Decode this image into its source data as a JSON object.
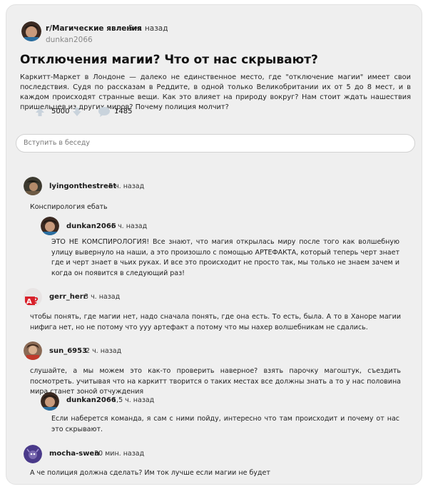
{
  "post": {
    "subreddit": "r/Магические явления",
    "time": "5 ч. назад",
    "author": "dunkan2066",
    "title": "Отключения магии? Что от нас скрывают?",
    "body": "Каркитт-Маркет в Лондоне — далеко не единственное место, где \"отключение магии\" имеет свои последствия. Судя по рассказам в Реддите, в одной только Великобритании их от 5 до 8 мест, и в каждом происходят странные вещи. Как это влияет на природу вокруг? Нам стоит ждать нашествия пришельцев из других миров? Почему полиция молчит?",
    "upvotes": "5000",
    "comments_count": "1485"
  },
  "input": {
    "placeholder": "Вступить в беседу"
  },
  "comments": [
    {
      "user": "lyingonthestreet",
      "time": "5 ч. назад",
      "text": "Конспирология ебать"
    },
    {
      "user": "dunkan2066",
      "time": "5 ч. назад",
      "text": "ЭТО НЕ КОМСПИРОЛОГИЯ! Все знают, что магия открылась миру после того как волшебную улицу вывернуло на наши, а это произошло с помощью АРТЕФАКТА, который теперь черт знает где и черт знает в чьих руках. И все это происходит не просто так, мы только не знаем зачем и когда он появится в следующий раз!"
    },
    {
      "user": "gerr_herr",
      "time": "3 ч. назад",
      "text": "чтобы понять, где магии нет, надо сначала понять, где она есть. То есть, была. А то в Ханоре магии нифига нет, но не потому что ууу артефакт а потому что мы нахер волшебникам не сдались."
    },
    {
      "user": "sun_6953",
      "time": "2 ч. назад",
      "text": "слушайте, а мы можем это как-то проверить наверное? взять парочку магоштук, съездить посмотреть. учитывая что на каркитт творится о таких местах все должны знать а то у нас половина мира станет зоной отчуждения"
    },
    {
      "user": "dunkan2066",
      "time": "1,5 ч. назад",
      "text": "Если наберется команда, я сам с ними пойду, интересно что там происходит и почему от нас это скрывают."
    },
    {
      "user": "mocha-swen",
      "time": "30 мин. назад",
      "text": "А че полиция должна сделать? Им ток лучше если магии не будет"
    }
  ],
  "colors": {
    "background": "#efefef",
    "icon_gray": "#c9d3dc"
  },
  "icons": [
    "upvote-icon",
    "downvote-icon",
    "comment-icon"
  ]
}
